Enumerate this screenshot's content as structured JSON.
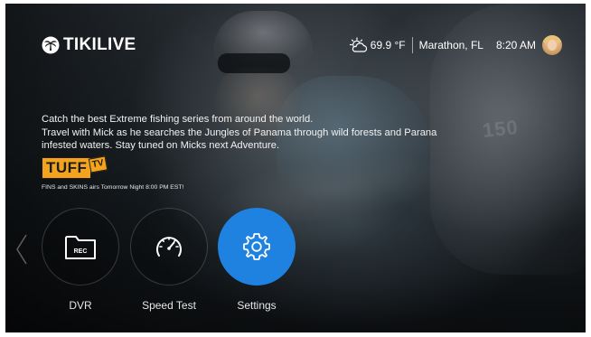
{
  "header": {
    "logo_text": "TIKILIVE",
    "temperature": "69.9 °F",
    "location": "Marathon, FL",
    "time": "8:20 AM"
  },
  "featured": {
    "description_lines": [
      "Catch the best Extreme fishing series from around the world.",
      "Travel with Mick as he searches the Jungles of Panama through wild forests and Parana",
      "infested waters. Stay tuned on Micks next Adventure."
    ],
    "channel_logo_main": "TUFF",
    "channel_logo_tv": "TV",
    "airs_text": "FINS and SKINS airs Tomorrow Night 8:00 PM EST!",
    "background_text": "150"
  },
  "menu": {
    "items": [
      {
        "label": "DVR",
        "icon": "folder-rec-icon",
        "icon_text": "REC",
        "selected": false
      },
      {
        "label": "Speed Test",
        "icon": "speedometer-icon",
        "selected": false
      },
      {
        "label": "Settings",
        "icon": "gear-icon",
        "selected": true
      }
    ]
  },
  "colors": {
    "accent": "#1f82e0",
    "tuff_orange": "#f3a41c",
    "text": "#ffffff"
  }
}
